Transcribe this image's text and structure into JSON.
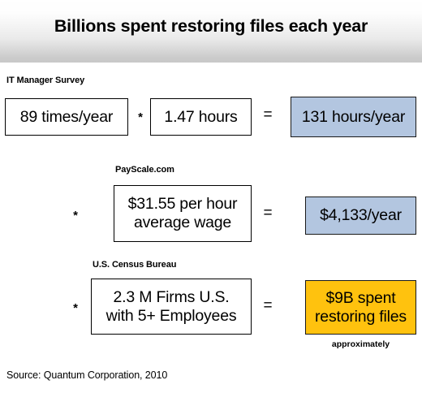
{
  "slide": {
    "title": "Billions spent restoring files each year",
    "source_note": "Source: Quantum Corporation, 2010",
    "approximately_note": "approximately",
    "colors": {
      "result_blue": "#b3c6e0",
      "result_orange": "#ffc20e",
      "banner_gradient_top": "#ffffff",
      "banner_gradient_bottom": "#c8c8c8",
      "background": "#ffffff",
      "text": "#000000"
    }
  },
  "rows": [
    {
      "source_label": "IT Manager Survey",
      "operand_1": "89 times/year",
      "operator_1": "*",
      "operand_2": "1.47 hours",
      "operator_2": "=",
      "result": "131 hours/year",
      "result_style": "blue"
    },
    {
      "source_label": "PayScale.com",
      "operator_1": "*",
      "operand_1": "$31.55 per hour average wage",
      "operand_1_line_1": "$31.55 per hour",
      "operand_1_line_2": "average wage",
      "operator_2": "=",
      "result": "$4,133/year",
      "result_style": "blue"
    },
    {
      "source_label": "U.S. Census Bureau",
      "operator_1": "*",
      "operand_1": "2.3 M Firms U.S. with 5+ Employees",
      "operand_1_line_1": "2.3 M Firms U.S.",
      "operand_1_line_2": "with 5+ Employees",
      "operator_2": "=",
      "result": "$9B spent restoring files",
      "result_line_1": "$9B spent",
      "result_line_2": "restoring files",
      "result_style": "orange"
    }
  ]
}
